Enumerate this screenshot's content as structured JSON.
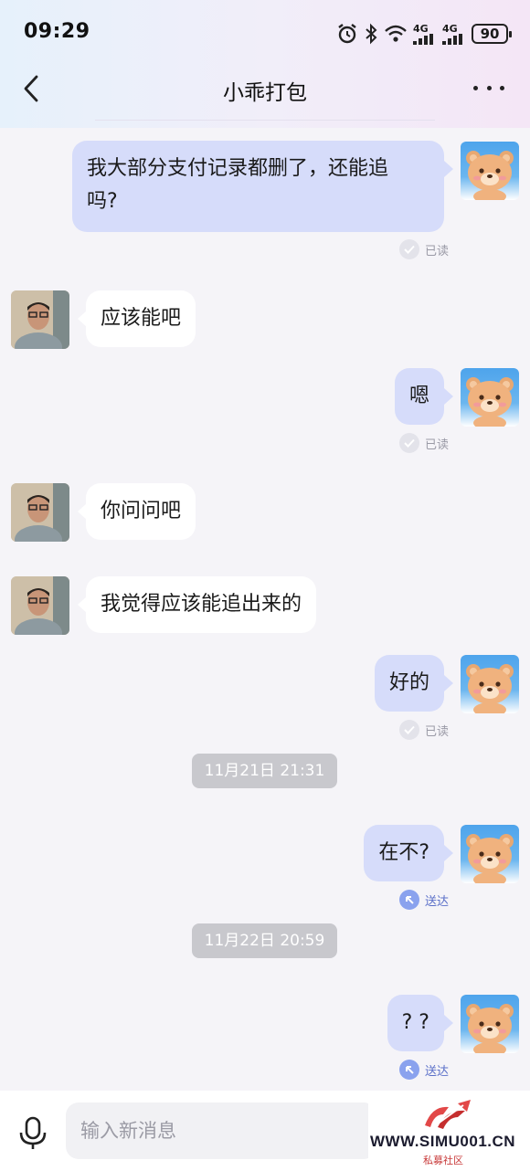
{
  "status_bar": {
    "time": "09:29",
    "net1": "4G",
    "net2": "4G",
    "battery": "90"
  },
  "header": {
    "title": "小乖打包"
  },
  "messages": [
    {
      "dir": "out",
      "text_line1": "我大部分支付记录都删了，还能追",
      "text_line2": "吗?",
      "receipt": "已读"
    },
    {
      "dir": "in",
      "text": "应该能吧"
    },
    {
      "dir": "out",
      "text": "嗯",
      "receipt": "已读"
    },
    {
      "dir": "in",
      "text": "你问问吧"
    },
    {
      "dir": "in",
      "text": "我觉得应该能追出来的"
    },
    {
      "dir": "out",
      "text": "好的",
      "receipt": "已读"
    },
    {
      "dir": "out",
      "text": "在不?",
      "receipt": "送达"
    },
    {
      "dir": "out",
      "text": "? ?",
      "receipt": "送达"
    }
  ],
  "timestamps": [
    "11月21日 21:31",
    "11月22日 20:59"
  ],
  "input": {
    "placeholder": "输入新消息"
  },
  "watermark": {
    "text": "WWW.SIMU001.CN",
    "sub": "私募社区"
  },
  "colors": {
    "outgoing_bubble": "#d6dcfa",
    "incoming_bubble": "#ffffff",
    "timestamp_bg": "#c8c8cd",
    "sent_accent": "#5a6fc8"
  }
}
